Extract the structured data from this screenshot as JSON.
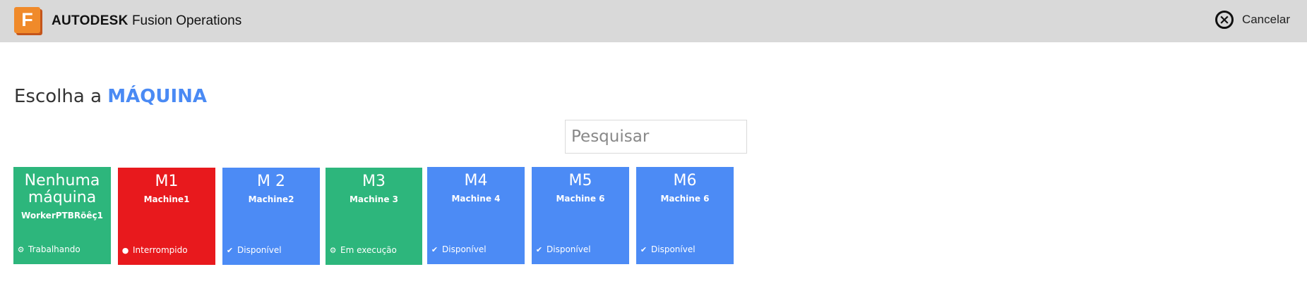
{
  "header": {
    "brand_strong": "AUTODESK",
    "brand_rest": "Fusion Operations",
    "logo_letter": "F",
    "cancel_label": "Cancelar",
    "cancel_icon": "close-circle-icon"
  },
  "page": {
    "title_prefix": "Escolha a",
    "title_accent": "MÁQUINA",
    "accent_color": "#4a8af4"
  },
  "search": {
    "placeholder": "Pesquisar",
    "value": ""
  },
  "machines": [
    {
      "code": "Nenhuma máquina",
      "name": "WorkerPTBRõêç1",
      "status": "Trabalhando",
      "status_icon": "gears-icon",
      "color": "#2db67c"
    },
    {
      "code": "M1",
      "name": "Machine1",
      "status": "Interrompido",
      "status_icon": "exclamation-circle-icon",
      "color": "#e8191d"
    },
    {
      "code": "M 2",
      "name": "Machine2",
      "status": "Disponível",
      "status_icon": "check-circle-icon",
      "color": "#4c8bf5"
    },
    {
      "code": "M3",
      "name": "Machine 3",
      "status": "Em execução",
      "status_icon": "gears-icon",
      "color": "#2db67c"
    },
    {
      "code": "M4",
      "name": "Machine 4",
      "status": "Disponível",
      "status_icon": "check-circle-icon",
      "color": "#4c8bf5"
    },
    {
      "code": "M5",
      "name": "Machine 6",
      "status": "Disponível",
      "status_icon": "check-circle-icon",
      "color": "#4c8bf5"
    },
    {
      "code": "M6",
      "name": "Machine 6",
      "status": "Disponível",
      "status_icon": "check-circle-icon",
      "color": "#4c8bf5"
    }
  ]
}
